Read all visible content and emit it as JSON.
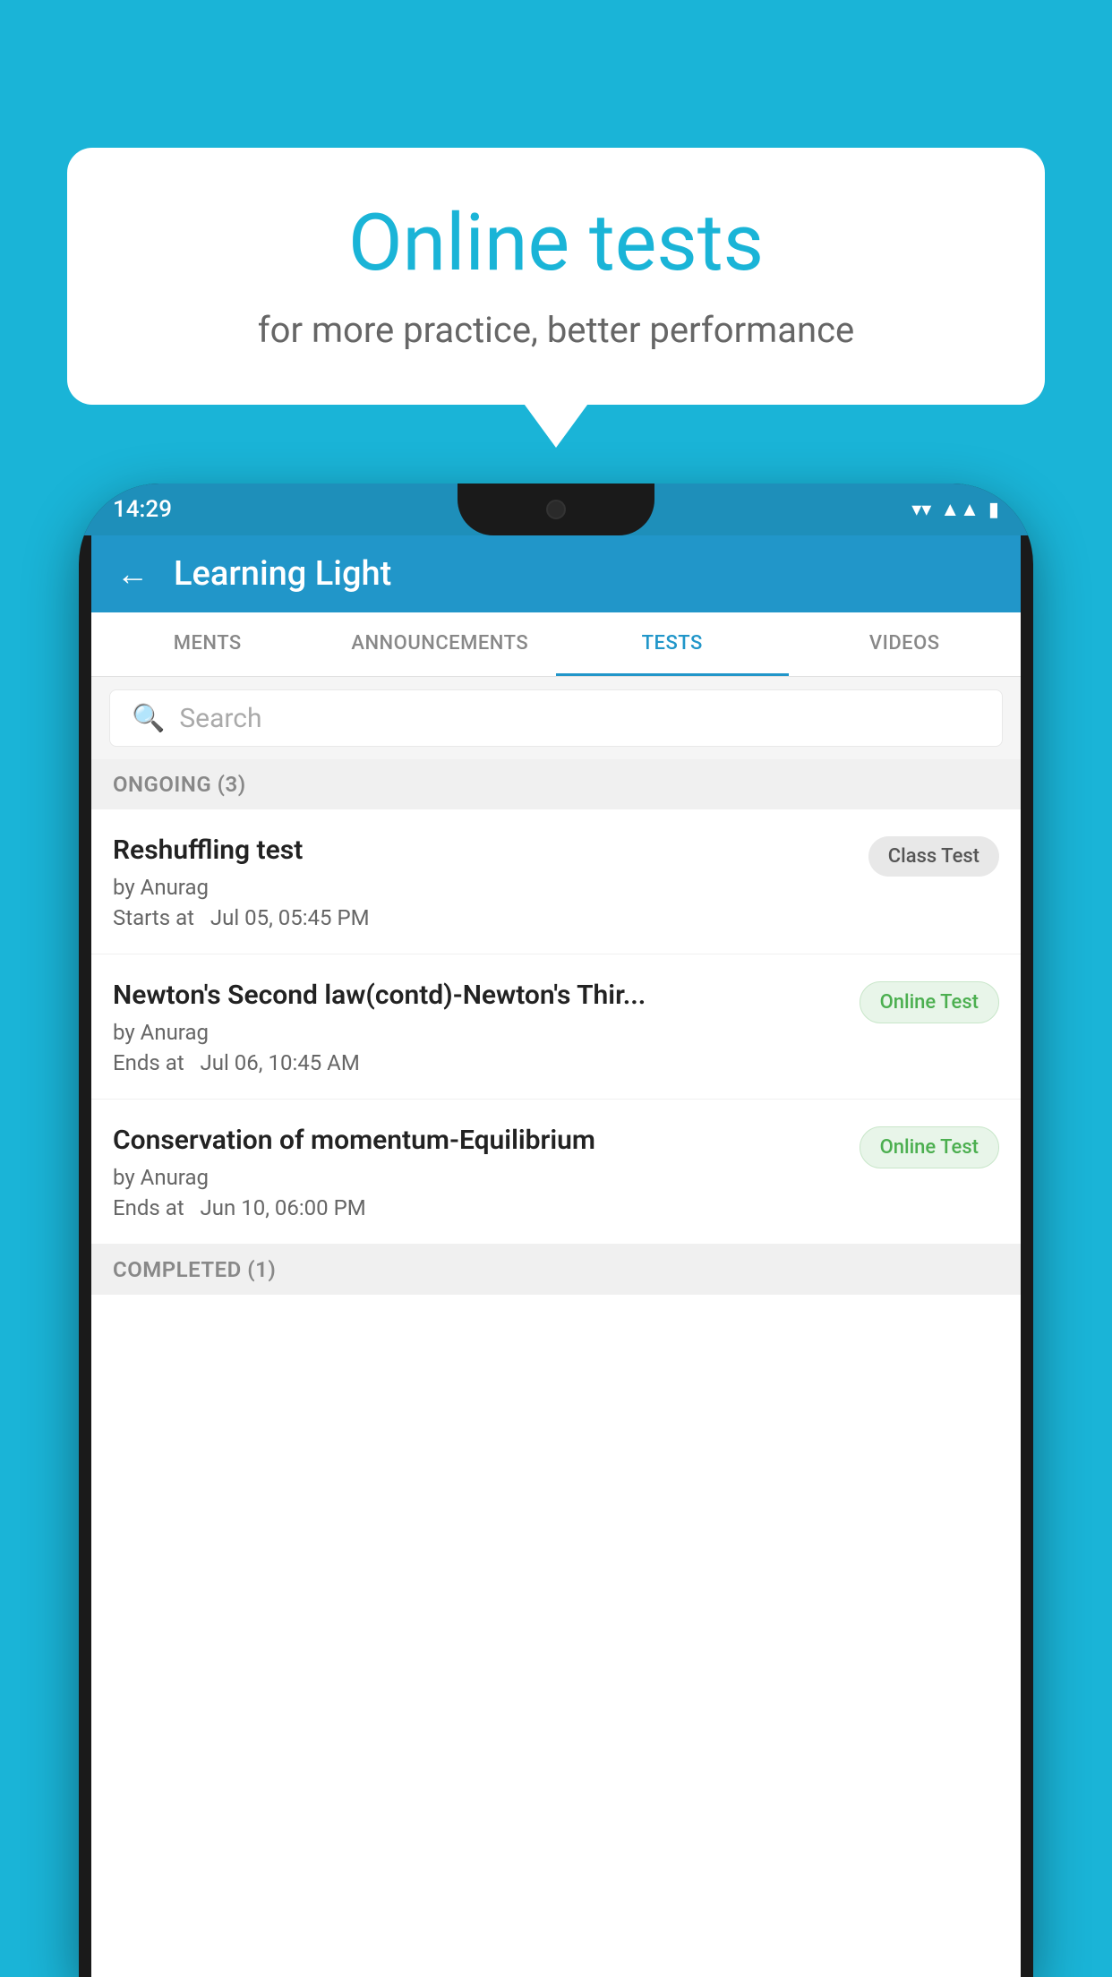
{
  "background": {
    "color": "#1ab4d7"
  },
  "bubble": {
    "title": "Online tests",
    "subtitle": "for more practice, better performance"
  },
  "phone": {
    "status_bar": {
      "time": "14:29",
      "wifi_icon": "▼",
      "signal_icon": "▲",
      "battery_icon": "▮"
    },
    "app_header": {
      "back_label": "←",
      "title": "Learning Light"
    },
    "tabs": [
      {
        "label": "MENTS",
        "active": false
      },
      {
        "label": "ANNOUNCEMENTS",
        "active": false
      },
      {
        "label": "TESTS",
        "active": true
      },
      {
        "label": "VIDEOS",
        "active": false
      }
    ],
    "search": {
      "placeholder": "Search"
    },
    "sections": [
      {
        "header": "ONGOING (3)",
        "items": [
          {
            "title": "Reshuffling test",
            "author": "by Anurag",
            "time_label": "Starts at",
            "time_value": "Jul 05, 05:45 PM",
            "badge": "Class Test",
            "badge_type": "class"
          },
          {
            "title": "Newton's Second law(contd)-Newton's Thir...",
            "author": "by Anurag",
            "time_label": "Ends at",
            "time_value": "Jul 06, 10:45 AM",
            "badge": "Online Test",
            "badge_type": "online"
          },
          {
            "title": "Conservation of momentum-Equilibrium",
            "author": "by Anurag",
            "time_label": "Ends at",
            "time_value": "Jun 10, 06:00 PM",
            "badge": "Online Test",
            "badge_type": "online"
          }
        ]
      },
      {
        "header": "COMPLETED (1)",
        "items": []
      }
    ]
  }
}
